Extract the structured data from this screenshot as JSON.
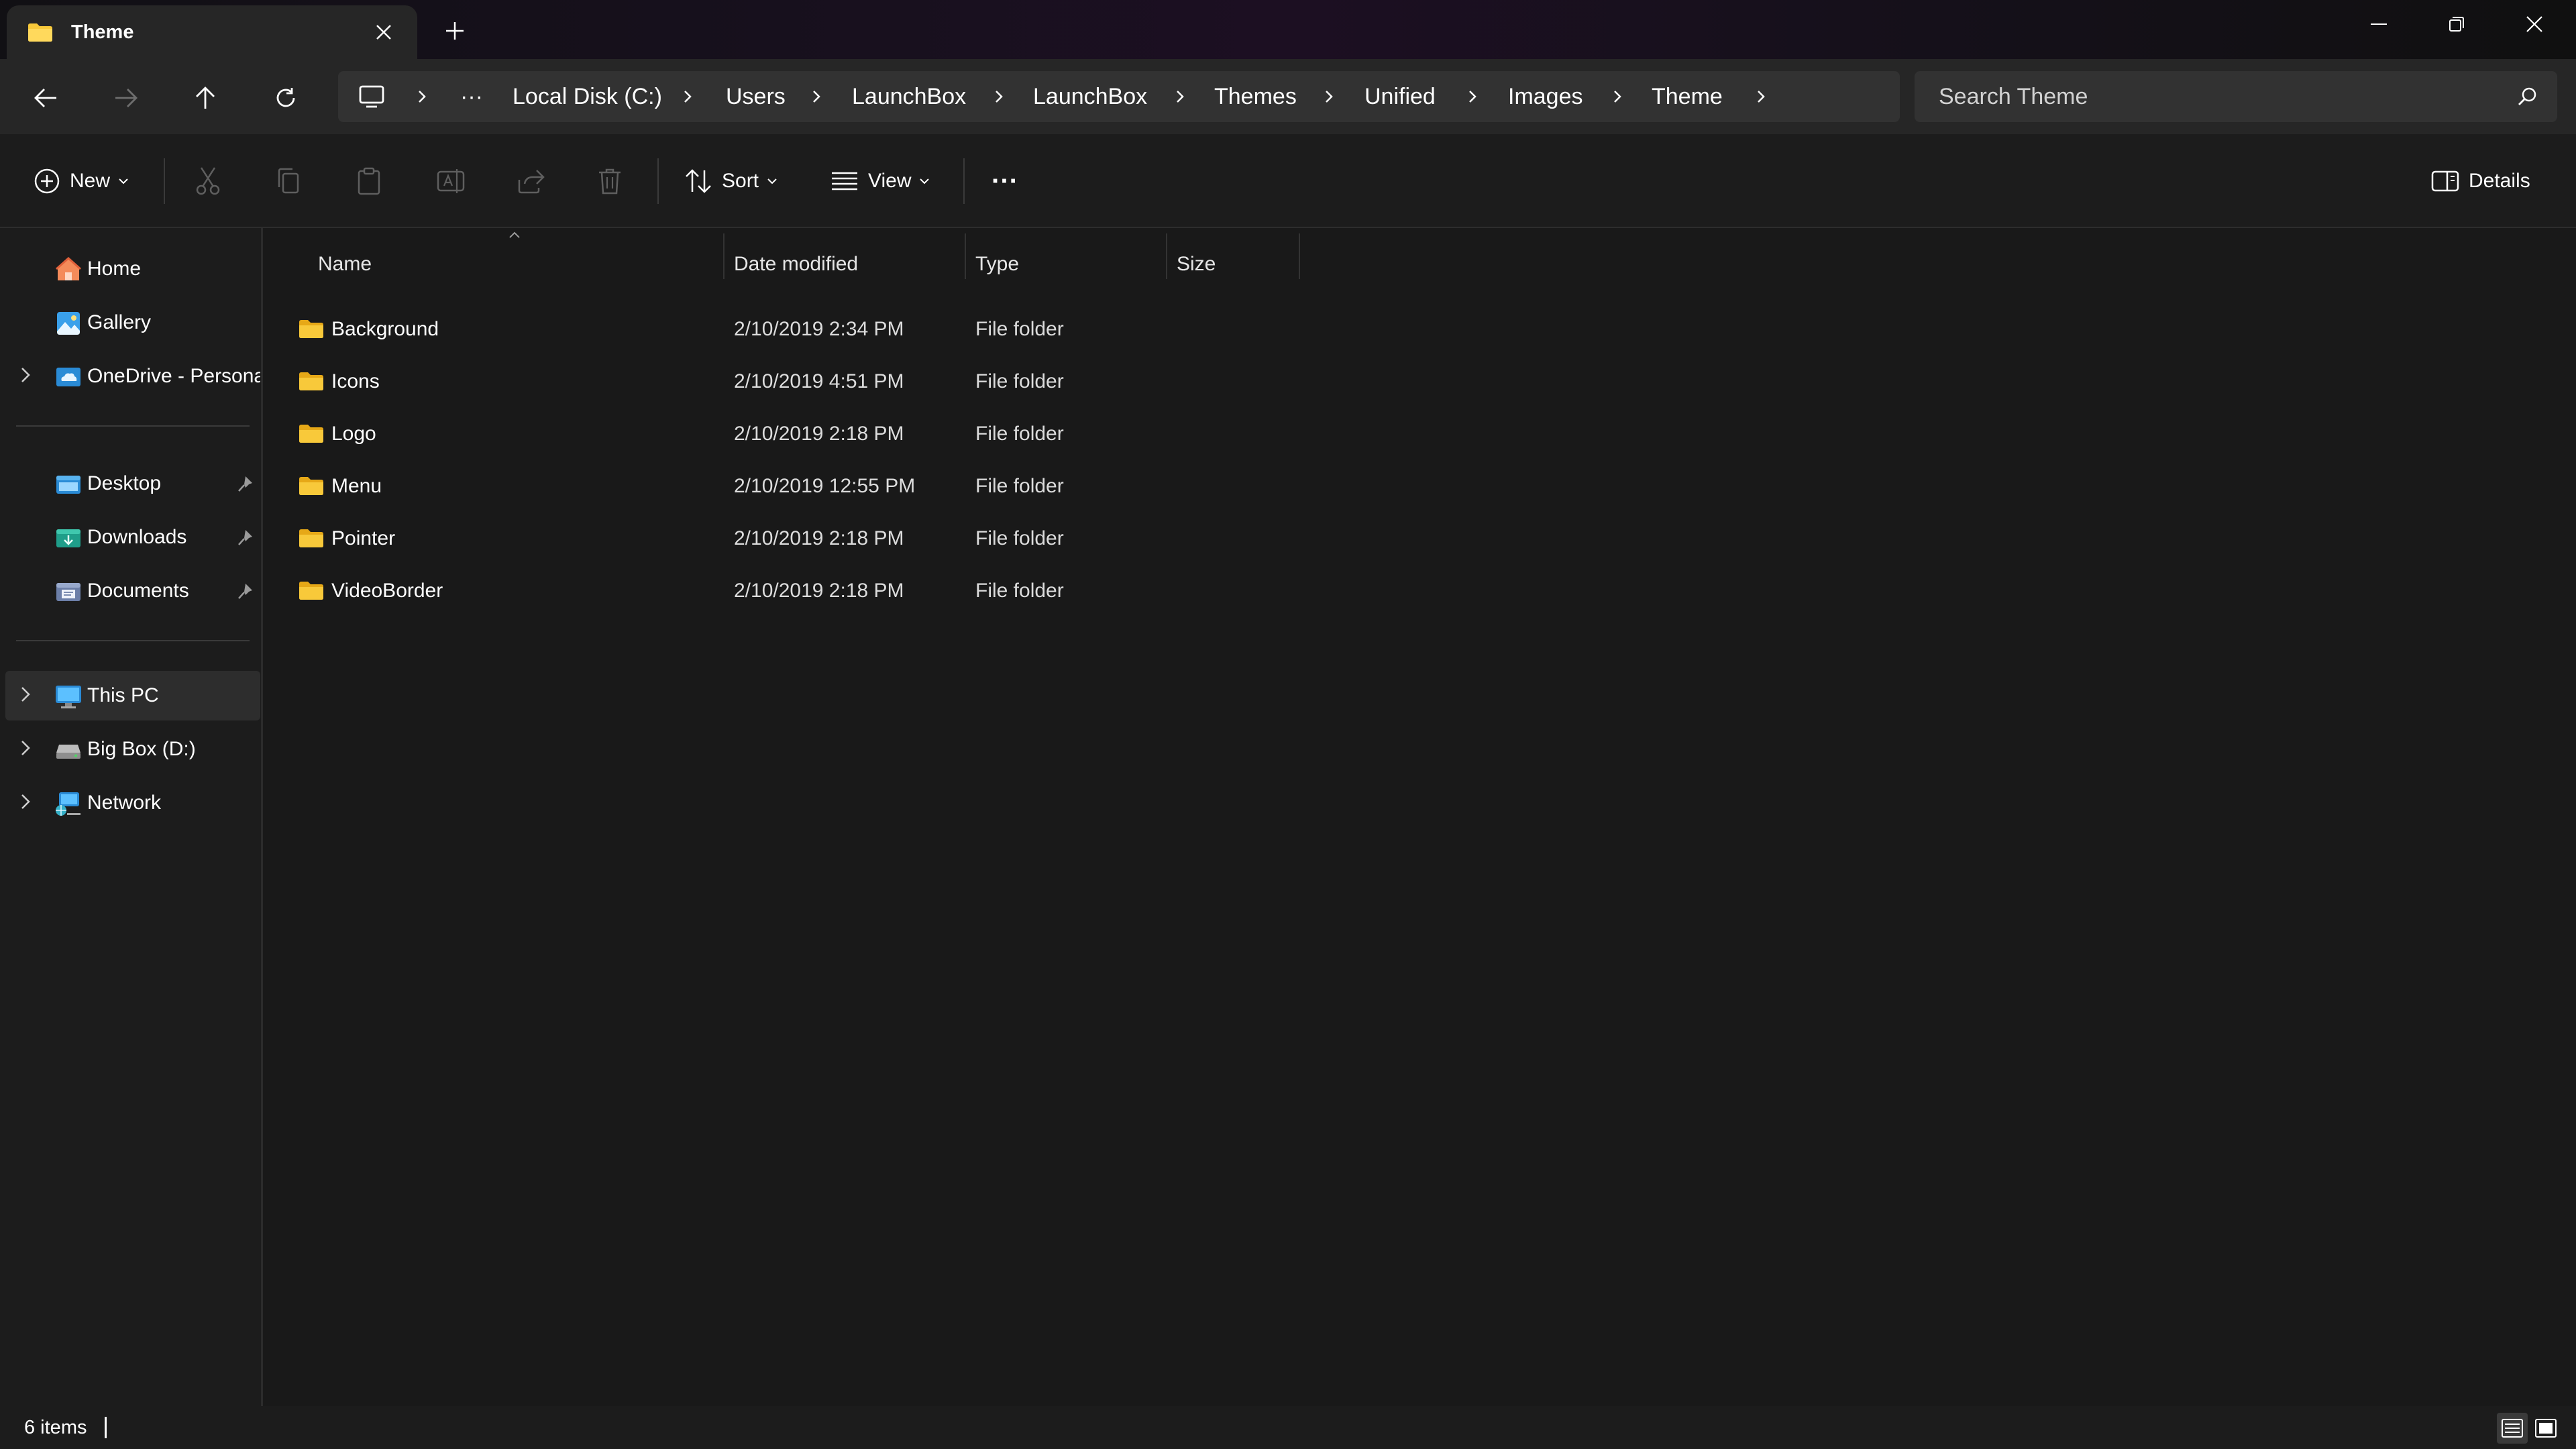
{
  "window": {
    "tab_title": "Theme",
    "new_tab_glyph": "+"
  },
  "navigation": {
    "back": "arrow-left-icon",
    "forward": "arrow-right-icon",
    "up": "arrow-up-icon",
    "refresh": "refresh-icon"
  },
  "breadcrumbs": {
    "more": "···",
    "items": [
      "Local Disk (C:)",
      "Users",
      "LaunchBox",
      "LaunchBox",
      "Themes",
      "Unified",
      "Images",
      "Theme"
    ]
  },
  "search": {
    "placeholder": "Search Theme"
  },
  "command_bar": {
    "new_label": "New",
    "sort_label": "Sort",
    "view_label": "View",
    "more_label": "···",
    "details_label": "Details"
  },
  "sidebar": {
    "items": [
      {
        "label": "Home",
        "icon": "home-icon"
      },
      {
        "label": "Gallery",
        "icon": "gallery-icon"
      },
      {
        "label": "OneDrive - Personal",
        "icon": "onedrive-icon"
      },
      {
        "label": "Desktop",
        "icon": "desktop-folder-icon"
      },
      {
        "label": "Downloads",
        "icon": "downloads-folder-icon"
      },
      {
        "label": "Documents",
        "icon": "documents-folder-icon"
      },
      {
        "label": "This PC",
        "icon": "this-pc-icon"
      },
      {
        "label": "Big Box (D:)",
        "icon": "drive-icon"
      },
      {
        "label": "Network",
        "icon": "network-icon"
      }
    ]
  },
  "file_list": {
    "columns": [
      "Name",
      "Date modified",
      "Type",
      "Size"
    ],
    "rows": [
      {
        "name": "Background",
        "date": "2/10/2019 2:34 PM",
        "type": "File folder",
        "size": ""
      },
      {
        "name": "Icons",
        "date": "2/10/2019 4:51 PM",
        "type": "File folder",
        "size": ""
      },
      {
        "name": "Logo",
        "date": "2/10/2019 2:18 PM",
        "type": "File folder",
        "size": ""
      },
      {
        "name": "Menu",
        "date": "2/10/2019 12:55 PM",
        "type": "File folder",
        "size": ""
      },
      {
        "name": "Pointer",
        "date": "2/10/2019 2:18 PM",
        "type": "File folder",
        "size": ""
      },
      {
        "name": "VideoBorder",
        "date": "2/10/2019 2:18 PM",
        "type": "File folder",
        "size": ""
      }
    ]
  },
  "status": {
    "item_count": "6 items"
  },
  "colors": {
    "background": "#191919",
    "panel": "#1c1c1c",
    "folder_yellow": "#f8c93a",
    "accent_blue": "#4cc2ff"
  }
}
